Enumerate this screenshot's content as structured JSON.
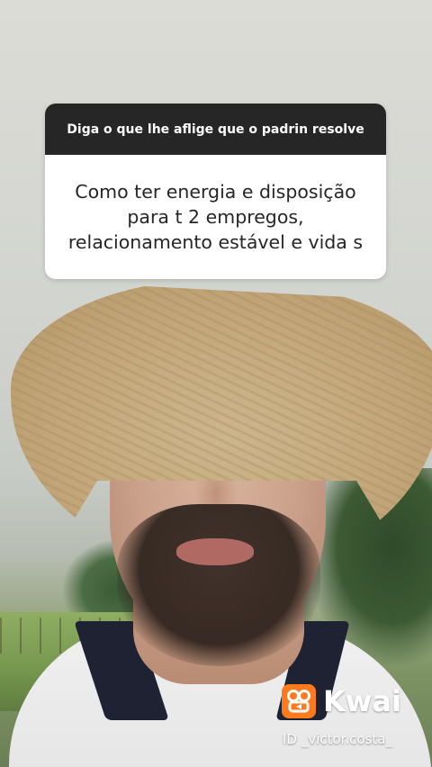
{
  "question_sticker": {
    "prompt": "Diga o que lhe aflige que o padrin resolve",
    "answer": "Como ter energia e disposição\npara t 2 empregos,\nrelacionamento estável e vida s"
  },
  "watermark": {
    "brand": "Kwai",
    "user_id": "ID _victor.costa_",
    "icon": "kwai-logo-icon",
    "brand_color": "#ff7a1c"
  },
  "colors": {
    "sticker_header": "#262626",
    "sticker_body": "#ffffff"
  }
}
